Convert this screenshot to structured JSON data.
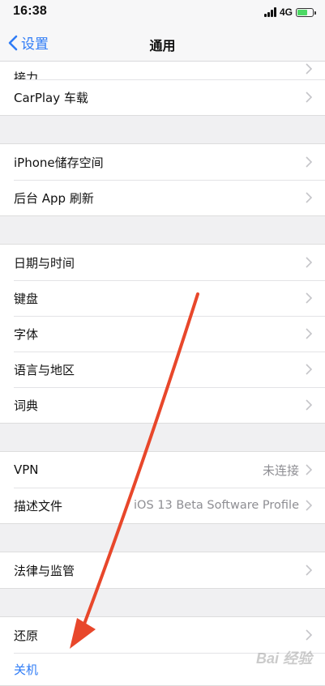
{
  "status_bar": {
    "time": "16:38",
    "network": "4G"
  },
  "nav": {
    "back_label": "设置",
    "title": "通用"
  },
  "sections": {
    "first": {
      "cut_label": "接力",
      "carplay": "CarPlay 车载"
    },
    "storage": {
      "iphone_storage": "iPhone储存空间",
      "background_refresh": "后台 App 刷新"
    },
    "datetime": {
      "date_time": "日期与时间",
      "keyboard": "键盘",
      "fonts": "字体",
      "language_region": "语言与地区",
      "dictionary": "词典"
    },
    "network": {
      "vpn": "VPN",
      "vpn_status": "未连接",
      "profile": "描述文件",
      "profile_value": "iOS 13 Beta Software Profile"
    },
    "legal": {
      "legal_regulatory": "法律与监管"
    },
    "reset": {
      "reset": "还原",
      "shutdown": "关机"
    }
  },
  "watermark": "Bai 经验",
  "colors": {
    "accent": "#2f7cf6",
    "arrow": "#e8472b",
    "battery": "#4cd964"
  }
}
